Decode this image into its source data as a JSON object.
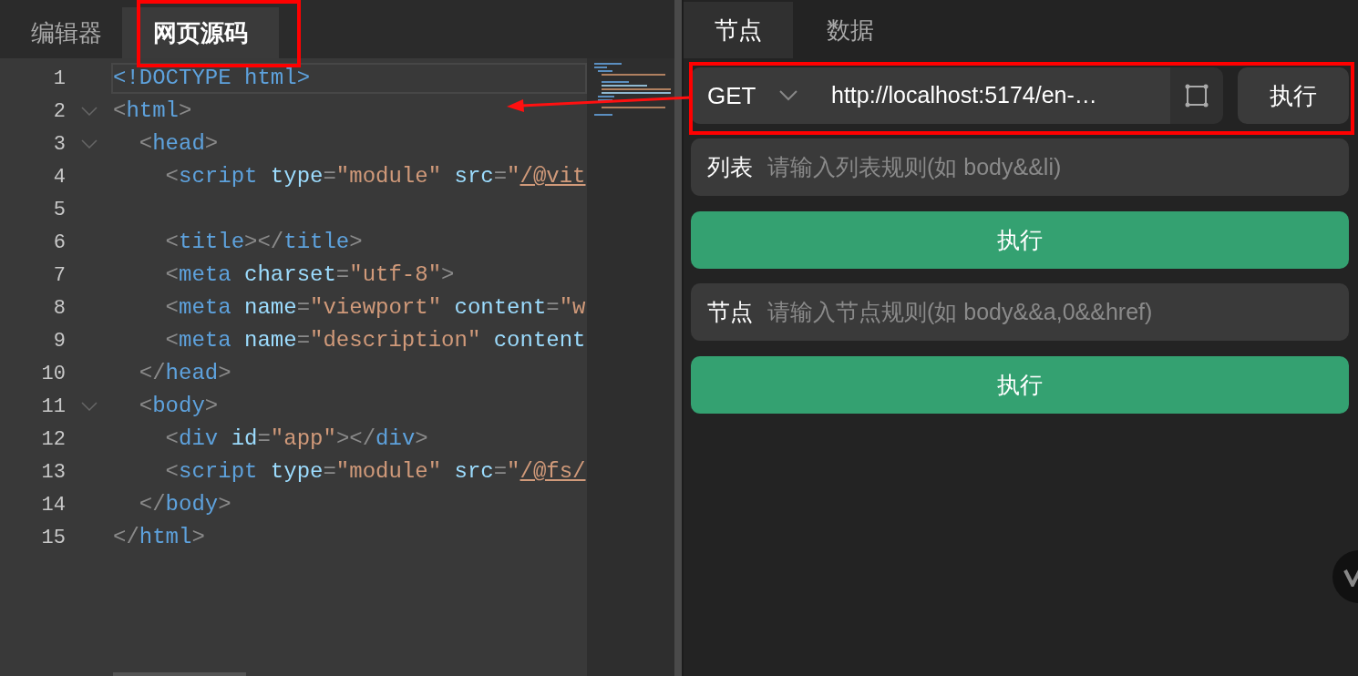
{
  "left_tabs": [
    {
      "label": "编辑器",
      "selected": false
    },
    {
      "label": "网页源码",
      "selected": true
    }
  ],
  "code_lines": [
    {
      "number": "1",
      "fold": false,
      "current": true,
      "tokens": [
        {
          "kind": "tag",
          "text": "<!DOCTYPE html>"
        }
      ]
    },
    {
      "number": "2",
      "fold": true,
      "current": false,
      "tokens": [
        {
          "kind": "punct",
          "text": "<"
        },
        {
          "kind": "tag",
          "text": "html"
        },
        {
          "kind": "punct",
          "text": ">"
        }
      ]
    },
    {
      "number": "3",
      "fold": true,
      "current": false,
      "tokens": [
        {
          "kind": "punct",
          "text": "  <"
        },
        {
          "kind": "tag",
          "text": "head"
        },
        {
          "kind": "punct",
          "text": ">"
        }
      ]
    },
    {
      "number": "4",
      "fold": false,
      "current": false,
      "tokens": [
        {
          "kind": "punct",
          "text": "    <"
        },
        {
          "kind": "tag",
          "text": "script"
        },
        {
          "kind": "attr",
          "text": " type"
        },
        {
          "kind": "punct",
          "text": "="
        },
        {
          "kind": "string",
          "text": "\"module\""
        },
        {
          "kind": "attr",
          "text": " src"
        },
        {
          "kind": "punct",
          "text": "="
        },
        {
          "kind": "string",
          "text": "\""
        },
        {
          "kind": "link",
          "text": "/@vit"
        }
      ]
    },
    {
      "number": "5",
      "fold": false,
      "current": false
    },
    {
      "number": "6",
      "fold": false,
      "current": false,
      "tokens": [
        {
          "kind": "punct",
          "text": "    <"
        },
        {
          "kind": "tag",
          "text": "title"
        },
        {
          "kind": "punct",
          "text": "></"
        },
        {
          "kind": "tag",
          "text": "title"
        },
        {
          "kind": "punct",
          "text": ">"
        }
      ]
    },
    {
      "number": "7",
      "fold": false,
      "current": false,
      "tokens": [
        {
          "kind": "punct",
          "text": "    <"
        },
        {
          "kind": "tag",
          "text": "meta"
        },
        {
          "kind": "attr",
          "text": " charset"
        },
        {
          "kind": "punct",
          "text": "="
        },
        {
          "kind": "string",
          "text": "\"utf-8\""
        },
        {
          "kind": "punct",
          "text": ">"
        }
      ]
    },
    {
      "number": "8",
      "fold": false,
      "current": false,
      "tokens": [
        {
          "kind": "punct",
          "text": "    <"
        },
        {
          "kind": "tag",
          "text": "meta"
        },
        {
          "kind": "attr",
          "text": " name"
        },
        {
          "kind": "punct",
          "text": "="
        },
        {
          "kind": "string",
          "text": "\"viewport\""
        },
        {
          "kind": "attr",
          "text": " content"
        },
        {
          "kind": "punct",
          "text": "="
        },
        {
          "kind": "string",
          "text": "\"w"
        }
      ]
    },
    {
      "number": "9",
      "fold": false,
      "current": false,
      "tokens": [
        {
          "kind": "punct",
          "text": "    <"
        },
        {
          "kind": "tag",
          "text": "meta"
        },
        {
          "kind": "attr",
          "text": " name"
        },
        {
          "kind": "punct",
          "text": "="
        },
        {
          "kind": "string",
          "text": "\"description\""
        },
        {
          "kind": "attr",
          "text": " content"
        }
      ]
    },
    {
      "number": "10",
      "fold": false,
      "current": false,
      "tokens": [
        {
          "kind": "punct",
          "text": "  </"
        },
        {
          "kind": "tag",
          "text": "head"
        },
        {
          "kind": "punct",
          "text": ">"
        }
      ]
    },
    {
      "number": "11",
      "fold": true,
      "current": false,
      "tokens": [
        {
          "kind": "punct",
          "text": "  <"
        },
        {
          "kind": "tag",
          "text": "body"
        },
        {
          "kind": "punct",
          "text": ">"
        }
      ]
    },
    {
      "number": "12",
      "fold": false,
      "current": false,
      "tokens": [
        {
          "kind": "punct",
          "text": "    <"
        },
        {
          "kind": "tag",
          "text": "div"
        },
        {
          "kind": "attr",
          "text": " id"
        },
        {
          "kind": "punct",
          "text": "="
        },
        {
          "kind": "string",
          "text": "\"app\""
        },
        {
          "kind": "punct",
          "text": "></"
        },
        {
          "kind": "tag",
          "text": "div"
        },
        {
          "kind": "punct",
          "text": ">"
        }
      ]
    },
    {
      "number": "13",
      "fold": false,
      "current": false,
      "tokens": [
        {
          "kind": "punct",
          "text": "    <"
        },
        {
          "kind": "tag",
          "text": "script"
        },
        {
          "kind": "attr",
          "text": " type"
        },
        {
          "kind": "punct",
          "text": "="
        },
        {
          "kind": "string",
          "text": "\"module\""
        },
        {
          "kind": "attr",
          "text": " src"
        },
        {
          "kind": "punct",
          "text": "="
        },
        {
          "kind": "string",
          "text": "\""
        },
        {
          "kind": "link",
          "text": "/@fs/"
        }
      ]
    },
    {
      "number": "14",
      "fold": false,
      "current": false,
      "tokens": [
        {
          "kind": "punct",
          "text": "  </"
        },
        {
          "kind": "tag",
          "text": "body"
        },
        {
          "kind": "punct",
          "text": ">"
        }
      ]
    },
    {
      "number": "15",
      "fold": false,
      "current": false,
      "tokens": [
        {
          "kind": "punct",
          "text": "</"
        },
        {
          "kind": "tag",
          "text": "html"
        },
        {
          "kind": "punct",
          "text": ">"
        }
      ]
    }
  ],
  "right_tabs": [
    {
      "label": "节点",
      "selected": true
    },
    {
      "label": "数据",
      "selected": false
    }
  ],
  "request": {
    "method": "GET",
    "url": "http://localhost:5174/en-…",
    "run_button": "执行"
  },
  "rules": [
    {
      "label": "列表",
      "placeholder": "请输入列表规则(如 body&&li)",
      "run_button": "执行"
    },
    {
      "label": "节点",
      "placeholder": "请输入节点规则(如 body&&a,0&&href)",
      "run_button": "执行"
    }
  ]
}
